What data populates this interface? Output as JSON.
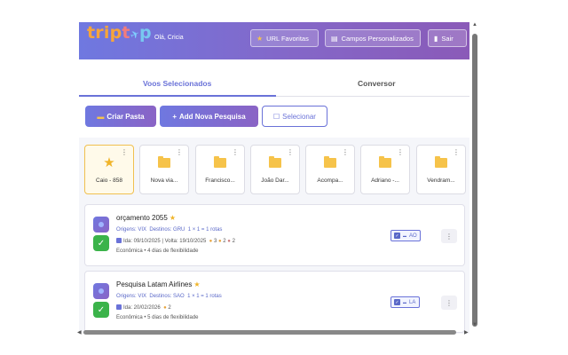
{
  "header": {
    "logo": {
      "part1": "trip",
      "part2": "t",
      "part3": "p"
    },
    "greeting": "Olá, Cricia",
    "fav_label": "URL Favoritas",
    "campos_label": "Campos Personalizados",
    "sair_label": "Sair"
  },
  "tabs": [
    {
      "label": "Voos Selecionados",
      "active": true
    },
    {
      "label": "Conversor",
      "active": false
    }
  ],
  "actions": {
    "criar_pasta": "Criar Pasta",
    "nova_pesquisa": "Add Nova Pesquisa",
    "selecionar": "Selecionar"
  },
  "folders": [
    {
      "label": "Caio - 858",
      "icon": "star-icon",
      "active": true
    },
    {
      "label": "Nova via...",
      "icon": "folder-icon"
    },
    {
      "label": "Francisco...",
      "icon": "folder-icon"
    },
    {
      "label": "João Dar...",
      "icon": "folder-icon"
    },
    {
      "label": "Acompa...",
      "icon": "folder-icon"
    },
    {
      "label": "Adriano -...",
      "icon": "folder-icon"
    },
    {
      "label": "Vendram...",
      "icon": "folder-icon"
    }
  ],
  "cards": [
    {
      "title": "orçamento 2055",
      "origens": "Origens: VIX",
      "destinos": "Destinos: GRU",
      "rotas": "1 × 1 = 1 rotas",
      "dates": "Ida: 09/10/2025 | Volta: 19/10/2025",
      "pax": "3",
      "pax2": "2",
      "pax3": "2",
      "info": "Econômica • 4 dias de flexibilidade",
      "badge": "AO"
    },
    {
      "title": "Pesquisa Latam Airlines",
      "origens": "Origens: VIX",
      "destinos": "Destinos: SAO",
      "rotas": "1 × 1 = 1 rotas",
      "dates": "Ida: 20/02/2026",
      "pax": "2",
      "info": "Econômica • 5 dias de flexibilidade",
      "badge": "LA"
    }
  ],
  "colors": {
    "accent": "#6a72d8",
    "star": "#f0b429",
    "folder": "#f6c34a",
    "check": "#3bb34a"
  }
}
